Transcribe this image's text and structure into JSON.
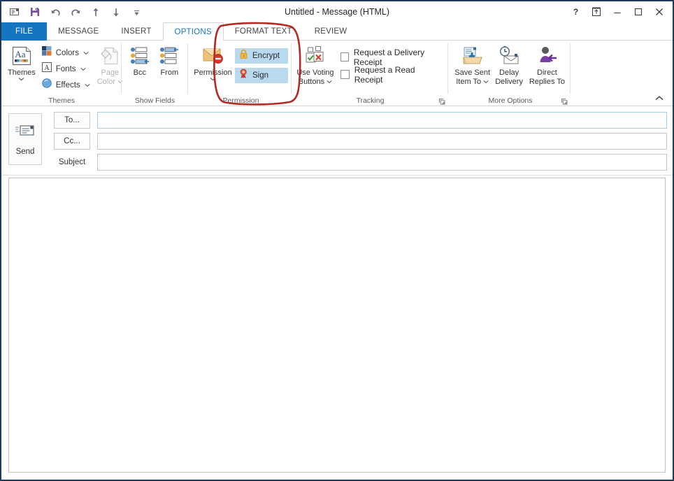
{
  "window": {
    "title": "Untitled - Message (HTML)",
    "border_color": "#1b3a5c",
    "controls": {
      "help_label": "?",
      "help_name": "help-icon",
      "restore_down_name": "ribbon-display-options-icon",
      "minimize_name": "minimize-icon",
      "maximize_name": "maximize-icon",
      "close_name": "close-icon"
    }
  },
  "quick_access_toolbar": {
    "items": [
      {
        "name": "envelope-icon",
        "tooltip": "Message"
      },
      {
        "name": "save-icon",
        "tooltip": "Save"
      },
      {
        "name": "undo-icon",
        "tooltip": "Undo"
      },
      {
        "name": "redo-icon",
        "tooltip": "Redo"
      },
      {
        "name": "previous-item-icon",
        "tooltip": "Previous Item"
      },
      {
        "name": "next-item-icon",
        "tooltip": "Next Item"
      },
      {
        "name": "customize-quick-access-toolbar-icon",
        "tooltip": "Customize Quick Access Toolbar"
      }
    ]
  },
  "tabs": [
    {
      "label": "FILE",
      "active": false,
      "kind": "file"
    },
    {
      "label": "MESSAGE",
      "active": false,
      "kind": "normal"
    },
    {
      "label": "INSERT",
      "active": false,
      "kind": "normal"
    },
    {
      "label": "OPTIONS",
      "active": true,
      "kind": "normal"
    },
    {
      "label": "FORMAT TEXT",
      "active": false,
      "kind": "normal"
    },
    {
      "label": "REVIEW",
      "active": false,
      "kind": "normal"
    }
  ],
  "ribbon": {
    "accent_color": "#1675bf",
    "collapse_icon": "chevron-up-icon",
    "groups": {
      "themes": {
        "label": "Themes",
        "themes_button": {
          "label": "Themes",
          "icon": "themes-icon",
          "has_caret": true
        },
        "colors_button": {
          "label": "Colors",
          "icon": "theme-colors-icon",
          "has_caret": true
        },
        "fonts_button": {
          "label": "Fonts",
          "icon": "theme-fonts-icon",
          "has_caret": true
        },
        "effects_button": {
          "label": "Effects",
          "icon": "theme-effects-icon",
          "has_caret": true
        },
        "page_color_button": {
          "label_line1": "Page",
          "label_line2": "Color",
          "icon": "page-color-icon",
          "has_caret": true,
          "disabled": true
        }
      },
      "show_fields": {
        "label": "Show Fields",
        "bcc_button": {
          "label": "Bcc",
          "icon": "bcc-field-icon"
        },
        "from_button": {
          "label": "From",
          "icon": "from-field-icon"
        }
      },
      "permission": {
        "label": "Permission",
        "permission_button": {
          "label": "Permission",
          "icon": "permission-icon",
          "has_caret": true
        },
        "encrypt_toggle": {
          "label": "Encrypt",
          "icon": "lock-icon",
          "pressed": true,
          "highlight_color": "#b8d9ee"
        },
        "sign_toggle": {
          "label": "Sign",
          "icon": "certificate-ribbon-icon",
          "pressed": true,
          "highlight_color": "#b8d9ee"
        }
      },
      "tracking": {
        "label": "Tracking",
        "voting_button": {
          "label_line1": "Use Voting",
          "label_line2": "Buttons",
          "icon": "voting-buttons-icon",
          "has_caret": true
        },
        "delivery_receipt": {
          "label": "Request a Delivery Receipt",
          "checked": false
        },
        "read_receipt": {
          "label": "Request a Read Receipt",
          "checked": false
        },
        "dialog_launcher": "dialog-box-launcher-icon"
      },
      "more_options": {
        "label": "More Options",
        "save_sent_item": {
          "label_line1": "Save Sent",
          "label_line2": "Item To",
          "icon": "save-sent-item-icon",
          "has_caret": true
        },
        "delay_delivery": {
          "label_line1": "Delay",
          "label_line2": "Delivery",
          "icon": "delay-delivery-icon"
        },
        "direct_replies": {
          "label_line1": "Direct",
          "label_line2": "Replies To",
          "icon": "direct-replies-icon"
        },
        "dialog_launcher": "dialog-box-launcher-icon"
      }
    }
  },
  "compose": {
    "send_button": {
      "label": "Send",
      "icon": "send-envelope-icon"
    },
    "to_field": {
      "button_label": "To...",
      "value": "",
      "placeholder": "",
      "focused": true
    },
    "cc_field": {
      "button_label": "Cc...",
      "value": "",
      "placeholder": "",
      "focused": false
    },
    "subject_field": {
      "label": "Subject",
      "value": "",
      "placeholder": "",
      "focused": false
    },
    "body": {
      "value": "",
      "placeholder": ""
    }
  },
  "annotation": {
    "shape": "rounded-rectangle",
    "color": "#c0392b",
    "target": "Permission group (Encrypt and Sign)"
  }
}
